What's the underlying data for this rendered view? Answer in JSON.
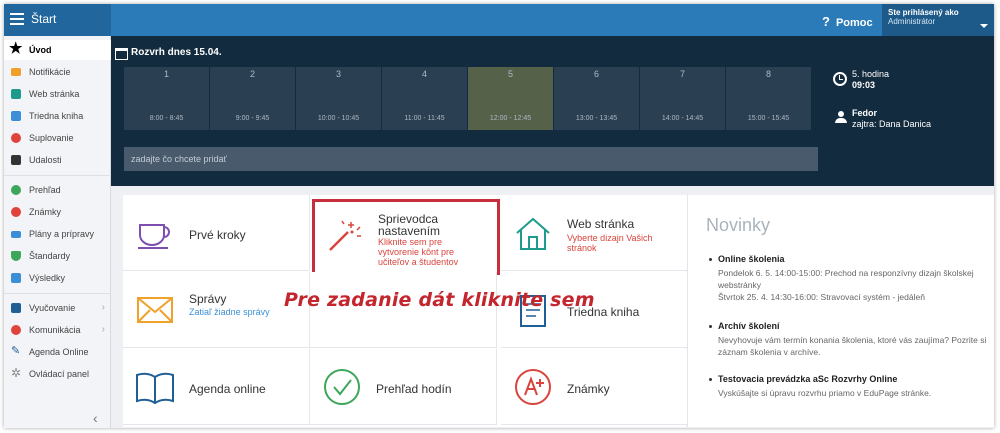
{
  "topbar": {
    "start_label": "Štart",
    "help_label": "Pomoc",
    "user_title": "Ste prihlásený ako",
    "user_role": "Administrátor"
  },
  "sidebar": {
    "items": [
      {
        "label": "Úvod",
        "icon": "star-icon"
      },
      {
        "label": "Notifikácie",
        "icon": "mail-icon"
      },
      {
        "label": "Web stránka",
        "icon": "home-icon"
      },
      {
        "label": "Triedna kniha",
        "icon": "book-icon"
      },
      {
        "label": "Suplovanie",
        "icon": "person-icon"
      },
      {
        "label": "Udalosti",
        "icon": "calendar-icon"
      },
      {
        "label": "Prehľad",
        "icon": "check-icon"
      },
      {
        "label": "Známky",
        "icon": "grade-icon"
      },
      {
        "label": "Plány a prípravy",
        "icon": "plan-icon"
      },
      {
        "label": "Štandardy",
        "icon": "shield-icon"
      },
      {
        "label": "Výsledky",
        "icon": "chart-icon"
      },
      {
        "label": "Vyučovanie",
        "icon": "briefcase-icon"
      },
      {
        "label": "Komunikácia",
        "icon": "chat-icon"
      },
      {
        "label": "Agenda Online",
        "icon": "pen-icon"
      },
      {
        "label": "Ovládací panel",
        "icon": "gear-icon"
      }
    ],
    "collapse_glyph": "‹"
  },
  "timetable": {
    "title": "Rozvrh dnes 15.04.",
    "periods": [
      {
        "num": "1",
        "time": "8:00 - 8:45"
      },
      {
        "num": "2",
        "time": "9:00 - 9:45"
      },
      {
        "num": "3",
        "time": "10:00 - 10:45"
      },
      {
        "num": "4",
        "time": "11:00 - 11:45"
      },
      {
        "num": "5",
        "time": "12:00 - 12:45"
      },
      {
        "num": "6",
        "time": "13:00 - 13:45"
      },
      {
        "num": "7",
        "time": "14:00 - 14:45"
      },
      {
        "num": "8",
        "time": "15:00 - 15:45"
      }
    ],
    "current_hour": "5. hodina",
    "current_time": "09:03",
    "teacher_name": "Fedor",
    "tomorrow": "zajtra: Dana Danica",
    "input_placeholder": "zadajte čo chcete pridať"
  },
  "tiles": {
    "first_steps": "Prvé kroky",
    "wizard_title": "Sprievodca nastavením",
    "wizard_sub": "Kliknite sem pre vytvorenie kônt pre učiteľov a študentov",
    "web_title": "Web stránka",
    "web_sub": "Vyberte dizajn Vašich stránok",
    "messages_title": "Správy",
    "messages_sub": "Zatiaľ žiadne správy",
    "class_book": "Triedna kniha",
    "agenda": "Agenda online",
    "hours": "Prehľad hodín",
    "grades": "Známky"
  },
  "annotation": "Pre zadanie dát kliknite sem",
  "news": {
    "title": "Novinky",
    "items": [
      {
        "title": "Online školenia",
        "body": "Pondelok 6. 5. 14:00-15:00: Prechod na responzívny dizajn školskej webstránky\nŠtvrtok 25. 4. 14:30-16:00: Stravovací systém - jedáleň"
      },
      {
        "title": "Archív školení",
        "body": "Nevyhovuje vám termín konania školenia, ktoré vás zaujíma? Pozrite si záznam školenia v archíve."
      },
      {
        "title": "Testovacia prevádzka aSc Rozvrhy Online",
        "body": "Vyskúšajte si úpravu rozvrhu priamo v EduPage stránke."
      }
    ]
  },
  "colors": {
    "topbar": "#2b7bb9",
    "timetable_bg": "#132b3e",
    "period_bg": "#2a3f52",
    "current_period": "#56614a",
    "highlight_red": "#c62f3b",
    "tile_purple": "#7d4fb0",
    "tile_orange": "#f0a12a",
    "tile_teal": "#1f9b8e",
    "tile_blue": "#1f5f95",
    "tile_green": "#3ea65a",
    "tile_red": "#d9443c"
  }
}
